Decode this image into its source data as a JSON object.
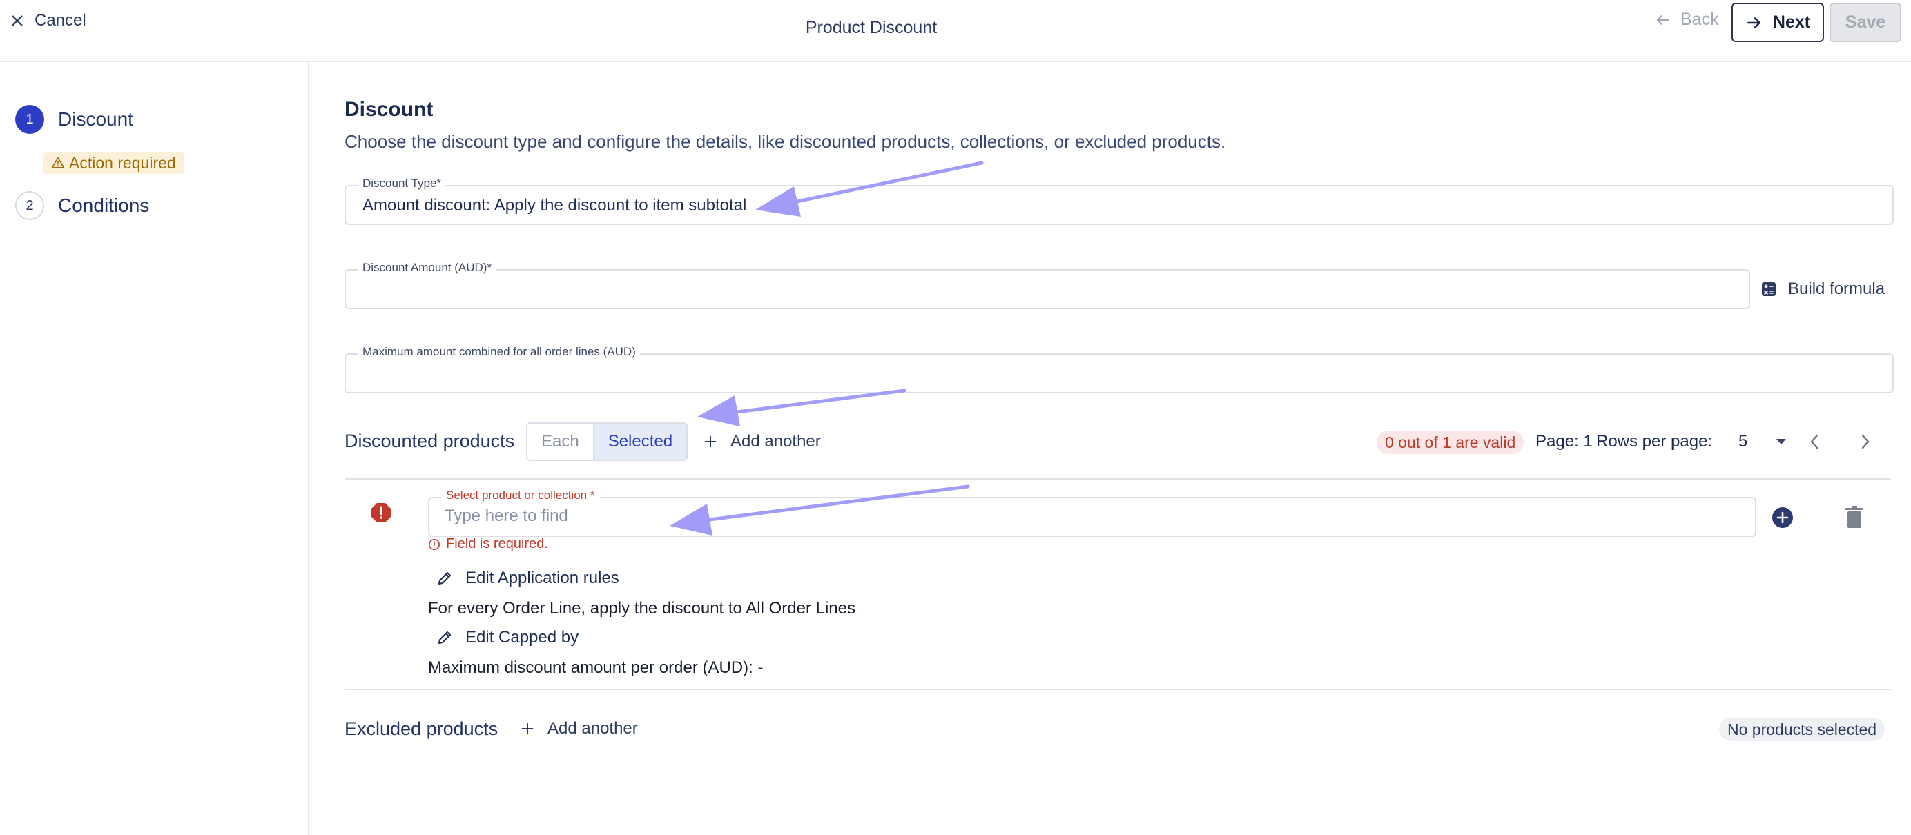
{
  "header": {
    "cancel_label": "Cancel",
    "title": "Product Discount",
    "back_label": "Back",
    "next_label": "Next",
    "save_label": "Save"
  },
  "steps": [
    {
      "number": "1",
      "label": "Discount",
      "status": "Action required"
    },
    {
      "number": "2",
      "label": "Conditions"
    }
  ],
  "main": {
    "title": "Discount",
    "description": "Choose the discount type and configure the details, like discounted products, collections, or excluded products.",
    "discount_type": {
      "label": "Discount Type*",
      "value": "Amount discount: Apply the discount to item subtotal"
    },
    "discount_amount": {
      "label": "Discount Amount (AUD)*",
      "value": ""
    },
    "build_formula_label": "Build formula",
    "max_amount": {
      "label": "Maximum amount combined for all order lines (AUD)",
      "value": ""
    }
  },
  "discounted_products": {
    "title": "Discounted products",
    "segment": {
      "each": "Each",
      "selected": "Selected",
      "active": "Selected"
    },
    "add_another_label": "Add another",
    "valid_badge": "0 out of 1 are valid",
    "page_label": "Page: 1",
    "rows_per_page_label": "Rows per page:",
    "rows_per_page_value": "5",
    "row": {
      "select_label": "Select product or collection *",
      "select_placeholder": "Type here to find",
      "error": "Field is required.",
      "edit_application_rules": "Edit Application rules",
      "application_rule_text": "For every Order Line, apply the discount to All Order Lines",
      "edit_capped_by": "Edit Capped by",
      "capped_text": "Maximum discount amount per order (AUD): -"
    }
  },
  "excluded_products": {
    "title": "Excluded products",
    "add_another_label": "Add another",
    "status_badge": "No products selected"
  },
  "colors": {
    "primary": "#2c3dc4",
    "error": "#c0392b",
    "warning": "#9d6a06",
    "annotation_arrow": "#a29cf8"
  },
  "icons": [
    "close-icon",
    "arrow-left-icon",
    "arrow-right-icon",
    "warning-triangle-icon",
    "calculator-icon",
    "plus-icon",
    "chevron-down-icon",
    "chevron-left-icon",
    "chevron-right-icon",
    "error-octagon-icon",
    "plus-circle-icon",
    "trash-icon",
    "pencil-icon",
    "info-circle-icon"
  ]
}
